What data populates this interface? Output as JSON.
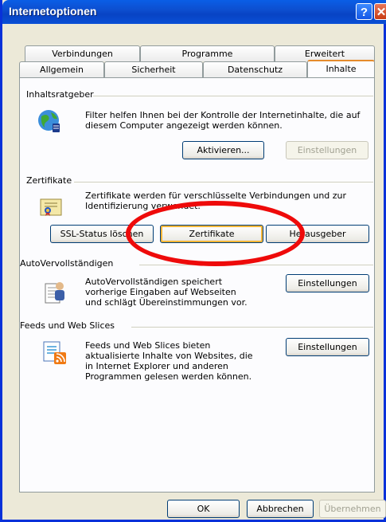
{
  "window": {
    "title": "Internetoptionen",
    "help_label": "?",
    "close_label": "✕"
  },
  "tabs": {
    "row1": [
      "Verbindungen",
      "Programme",
      "Erweitert"
    ],
    "row2": [
      "Allgemein",
      "Sicherheit",
      "Datenschutz",
      "Inhalte"
    ],
    "active": "Inhalte"
  },
  "inhaltsratgeber": {
    "title": "Inhaltsratgeber",
    "desc": [
      "Filter helfen Ihnen bei der Kontrolle der Internetinhalte, die auf",
      "diesem Computer angezeigt werden können."
    ],
    "activate": "Aktivieren...",
    "settings": "Einstellungen"
  },
  "zertifikate": {
    "title": "Zertifikate",
    "desc": [
      "Zertifikate werden für verschlüsselte Verbindungen und zur",
      "Identifizierung verwendet."
    ],
    "ssl": "SSL-Status löschen",
    "certs": "Zertifikate",
    "publishers": "Herausgeber"
  },
  "autocomplete": {
    "title": "AutoVervollständigen",
    "desc": [
      "AutoVervollständigen speichert",
      "vorherige Eingaben auf Webseiten",
      "und schlägt Übereinstimmungen vor."
    ],
    "settings": "Einstellungen"
  },
  "feeds": {
    "title": "Feeds und Web Slices",
    "desc": [
      "Feeds und Web Slices bieten",
      "aktualisierte Inhalte von Websites, die",
      "in Internet Explorer und anderen",
      "Programmen gelesen werden können."
    ],
    "settings": "Einstellungen"
  },
  "footer": {
    "ok": "OK",
    "cancel": "Abbrechen",
    "apply": "Übernehmen"
  },
  "colors": {
    "titlebar": "#0a4fd6",
    "annotation": "#ee0a0a",
    "dialog_bg": "#ece9d8"
  }
}
